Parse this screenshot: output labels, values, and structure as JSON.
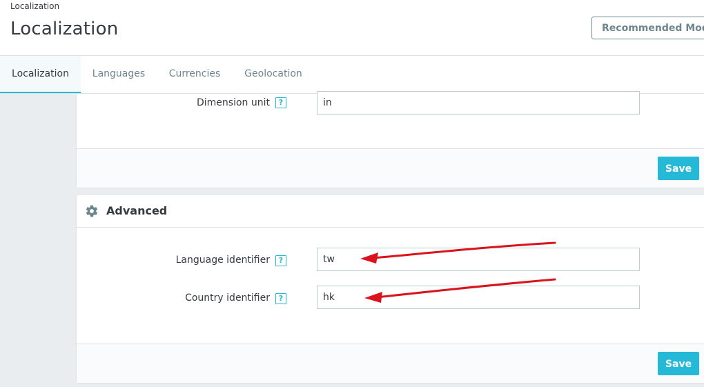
{
  "header": {
    "breadcrumb": "Localization",
    "title": "Localization",
    "recommended_button": "Recommended Modules"
  },
  "tabs": [
    {
      "label": "Localization",
      "active": true
    },
    {
      "label": "Languages",
      "active": false
    },
    {
      "label": "Currencies",
      "active": false
    },
    {
      "label": "Geolocation",
      "active": false
    }
  ],
  "units_panel": {
    "dimension_unit": {
      "label": "Dimension unit",
      "value": "in"
    },
    "save_label": "Save"
  },
  "advanced_panel": {
    "title": "Advanced",
    "icon": "gear-icon",
    "language_identifier": {
      "label": "Language identifier",
      "value": "tw"
    },
    "country_identifier": {
      "label": "Country identifier",
      "value": "hk"
    },
    "save_label": "Save"
  },
  "help_icon_text": "?",
  "colors": {
    "accent": "#25b9d7",
    "annotation_arrow": "#d9141d"
  }
}
